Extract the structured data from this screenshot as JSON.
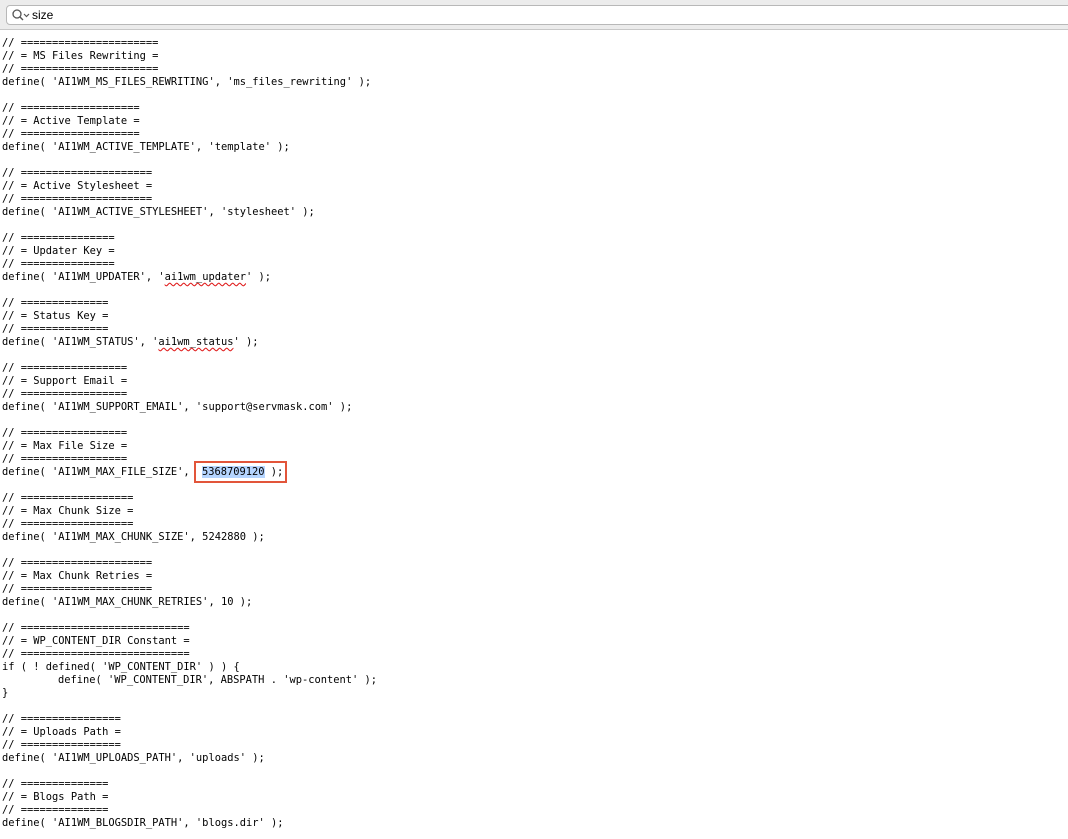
{
  "find_bar": {
    "query": "size"
  },
  "code_lines": [
    "// ======================",
    "// = MS Files Rewriting =",
    "// ======================",
    "define( 'AI1WM_MS_FILES_REWRITING', 'ms_files_rewriting' );",
    "",
    "// ===================",
    "// = Active Template =",
    "// ===================",
    "define( 'AI1WM_ACTIVE_TEMPLATE', 'template' );",
    "",
    "// =====================",
    "// = Active Stylesheet =",
    "// =====================",
    "define( 'AI1WM_ACTIVE_STYLESHEET', 'stylesheet' );",
    "",
    "// ===============",
    "// = Updater Key =",
    "// ===============",
    "define( 'AI1WM_UPDATER', 'ai1wm_updater' );",
    "",
    "// ==============",
    "// = Status Key =",
    "// ==============",
    "define( 'AI1WM_STATUS', 'ai1wm_status' );",
    "",
    "// =================",
    "// = Support Email =",
    "// =================",
    "define( 'AI1WM_SUPPORT_EMAIL', 'support@servmask.com' );",
    "",
    "// =================",
    "// = Max File Size =",
    "// =================",
    "define( 'AI1WM_MAX_FILE_SIZE', 5368709120 );",
    "",
    "// ==================",
    "// = Max Chunk Size =",
    "// ==================",
    "define( 'AI1WM_MAX_CHUNK_SIZE', 5242880 );",
    "",
    "// =====================",
    "// = Max Chunk Retries =",
    "// =====================",
    "define( 'AI1WM_MAX_CHUNK_RETRIES', 10 );",
    "",
    "// ===========================",
    "// = WP_CONTENT_DIR Constant =",
    "// ===========================",
    "if ( ! defined( 'WP_CONTENT_DIR' ) ) {",
    "define( 'WP_CONTENT_DIR', ABSPATH . 'wp-content' );",
    "}",
    "",
    "// ================",
    "// = Uploads Path =",
    "// ================",
    "define( 'AI1WM_UPLOADS_PATH', 'uploads' );",
    "",
    "// ==============",
    "// = Blogs Path =",
    "// ==============",
    "define( 'AI1WM_BLOGSDIR_PATH', 'blogs.dir' );"
  ],
  "spellcheck_words": [
    "ai1wm_updater",
    "ai1wm_status"
  ],
  "indented_lines": [
    49
  ],
  "highlight": {
    "line": 33,
    "prefix": "define( 'AI1WM_MAX_FILE_SIZE', ",
    "selected": "5368709120",
    "suffix": " );",
    "outline_color": "#e2553a",
    "selection_color": "#b5d5ff"
  },
  "icons": {
    "find": "search-dropdown-icon"
  }
}
